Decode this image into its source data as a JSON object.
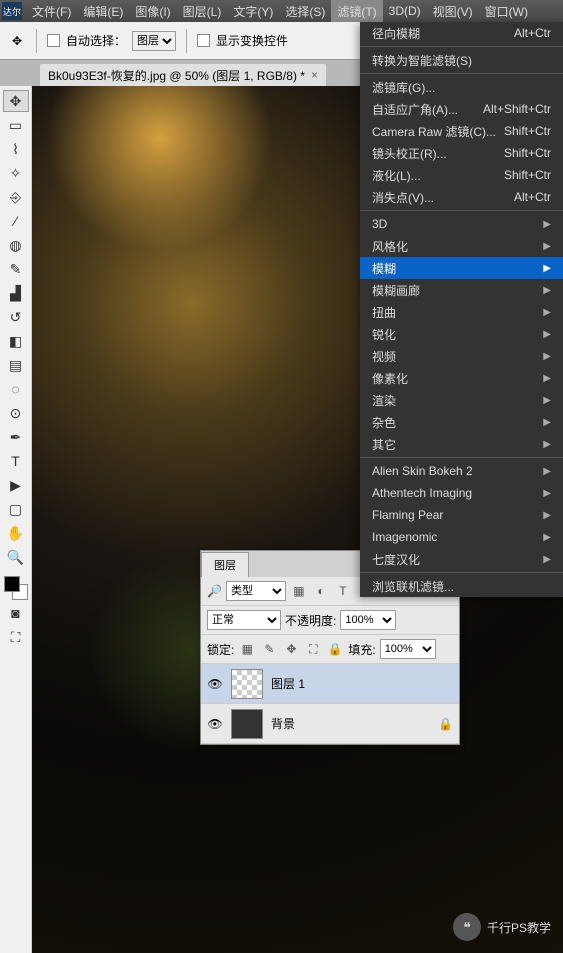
{
  "menubar": {
    "logo": "达尔",
    "items": [
      "文件(F)",
      "编辑(E)",
      "图像(I)",
      "图层(L)",
      "文字(Y)",
      "选择(S)",
      "滤镜(T)",
      "3D(D)",
      "视图(V)",
      "窗口(W)"
    ]
  },
  "options": {
    "autoSelect": "自动选择：",
    "autoSelectTarget": "图层",
    "showTransform": "显示变换控件"
  },
  "tab": {
    "title": "Bk0u93E3f-恢复的.jpg @ 50% (图层 1, RGB/8) *",
    "close": "×"
  },
  "dropdown": {
    "recent": {
      "label": "径向模糊",
      "shortcut": "Alt+Ctr"
    },
    "smart": "转换为智能滤镜(S)",
    "group1": [
      {
        "label": "滤镜库(G)...",
        "shortcut": ""
      },
      {
        "label": "自适应广角(A)...",
        "shortcut": "Alt+Shift+Ctr"
      },
      {
        "label": "Camera Raw 滤镜(C)...",
        "shortcut": "Shift+Ctr"
      },
      {
        "label": "镜头校正(R)...",
        "shortcut": "Shift+Ctr"
      },
      {
        "label": "液化(L)...",
        "shortcut": "Shift+Ctr"
      },
      {
        "label": "消失点(V)...",
        "shortcut": "Alt+Ctr"
      }
    ],
    "group2": [
      "3D",
      "风格化",
      "模糊",
      "模糊画廊",
      "扭曲",
      "锐化",
      "视频",
      "像素化",
      "渲染",
      "杂色",
      "其它"
    ],
    "group3": [
      "Alien Skin Bokeh 2",
      "Athentech Imaging",
      "Flaming Pear",
      "Imagenomic",
      "七度汉化"
    ],
    "browse": "浏览联机滤镜..."
  },
  "layersPanel": {
    "tab": "图层",
    "filterType": "类型",
    "blend": "正常",
    "opacityLabel": "不透明度:",
    "opacity": "100%",
    "lockLabel": "锁定:",
    "fillLabel": "填充:",
    "fill": "100%",
    "layers": [
      {
        "name": "图层 1",
        "visible": true,
        "selected": true,
        "checker": true,
        "locked": false
      },
      {
        "name": "背景",
        "visible": true,
        "selected": false,
        "checker": false,
        "locked": true
      }
    ]
  },
  "watermark": {
    "text": "千行PS教学"
  }
}
